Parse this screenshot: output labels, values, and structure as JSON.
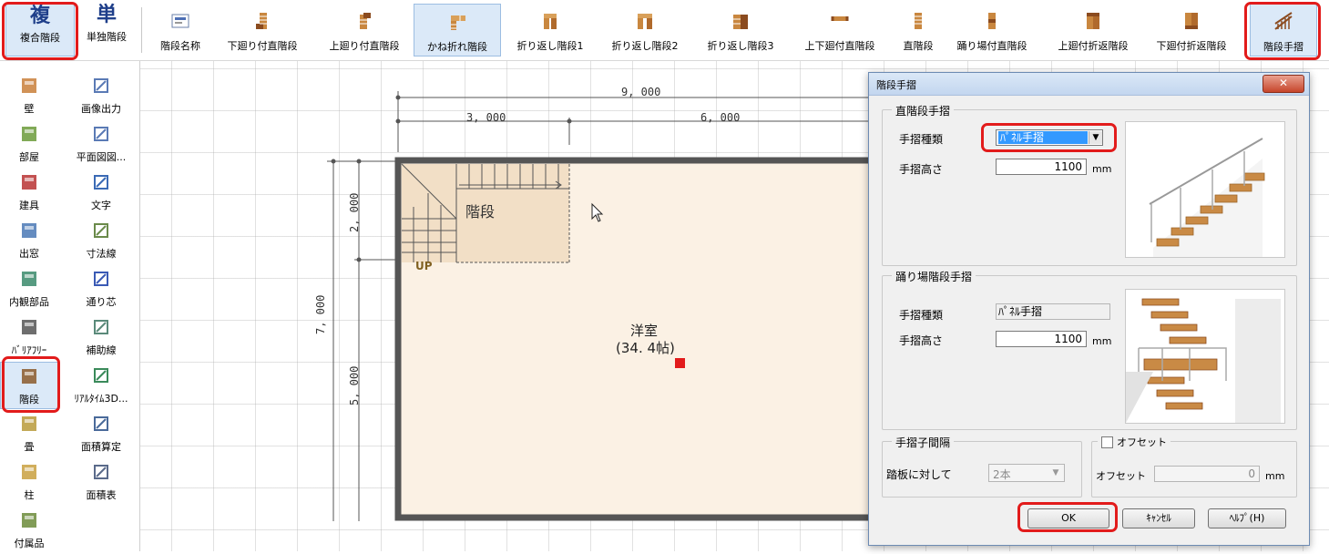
{
  "toolbar": {
    "items": [
      {
        "label": "複合階段",
        "glyph": "複"
      },
      {
        "label": "単独階段",
        "glyph": "単"
      },
      {
        "label": "階段名称"
      },
      {
        "label": "下廻り付直階段"
      },
      {
        "label": "上廻り付直階段"
      },
      {
        "label": "かね折れ階段"
      },
      {
        "label": "折り返し階段1"
      },
      {
        "label": "折り返し階段2"
      },
      {
        "label": "折り返し階段3"
      },
      {
        "label": "上下廻付直階段"
      },
      {
        "label": "直階段"
      },
      {
        "label": "踊り場付直階段"
      },
      {
        "label": "上廻付折返階段"
      },
      {
        "label": "下廻付折返階段"
      },
      {
        "label": "階段手摺"
      }
    ]
  },
  "left_panel": {
    "col1": [
      "壁",
      "部屋",
      "建具",
      "出窓",
      "内観部品",
      "ﾊﾞﾘｱﾌﾘｰ",
      "階段",
      "畳",
      "柱",
      "付属品"
    ],
    "col2": [
      "画像出力",
      "平面図図...",
      "文字",
      "寸法線",
      "通り芯",
      "補助線",
      "ﾘｱﾙﾀｲﾑ3D...",
      "面積算定",
      "面積表"
    ]
  },
  "plan": {
    "dim_total": "9, 000",
    "dim_left": "3, 000",
    "dim_right": "6, 000",
    "dim_v_total": "7, 000",
    "dim_v_top": "2, 000",
    "dim_v_bottom": "5, 000",
    "stair_label": "階段",
    "up_label": "UP",
    "room_name": "洋室",
    "room_area": "(34. 4帖)"
  },
  "dialog": {
    "title": "階段手摺",
    "straight": {
      "group_title": "直階段手摺",
      "type_label": "手摺種類",
      "type_value": "ﾊﾟﾈﾙ手摺",
      "height_label": "手摺高さ",
      "height_value": "1100",
      "unit": "mm"
    },
    "landing": {
      "group_title": "踊り場階段手摺",
      "type_label": "手摺種類",
      "type_value": "ﾊﾟﾈﾙ手摺",
      "height_label": "手摺高さ",
      "height_value": "1100",
      "unit": "mm"
    },
    "spacing": {
      "group_title": "手摺子間隔",
      "label": "踏板に対して",
      "value": "2本"
    },
    "offset": {
      "checkbox_label": "オフセット",
      "checked": false,
      "label": "オフセット",
      "value": "0",
      "unit": "mm"
    },
    "buttons": {
      "ok": "OK",
      "cancel": "ｷｬﾝｾﾙ",
      "help": "ﾍﾙﾌﾟ(H)"
    }
  },
  "colors": {
    "highlight_red": "#e21b1b",
    "floor_fill": "#fbf1e4",
    "stair_fill": "#f2dfc6",
    "wall": "#555555",
    "accent_blue": "#1f3f8a"
  }
}
